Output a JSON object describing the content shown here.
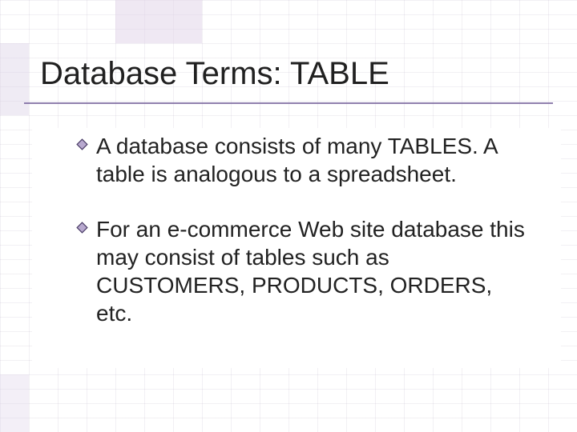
{
  "slide": {
    "title": "Database Terms: TABLE",
    "bullets": [
      "A database consists of many TABLES.  A table is analogous to a spreadsheet.",
      "For an e-commerce Web site database this may consist of tables such as CUSTOMERS, PRODUCTS, ORDERS, etc."
    ]
  },
  "colors": {
    "accent": "#7d6aa0",
    "bullet_border": "#4a3c66",
    "bullet_fill": "#b8a9cf"
  }
}
